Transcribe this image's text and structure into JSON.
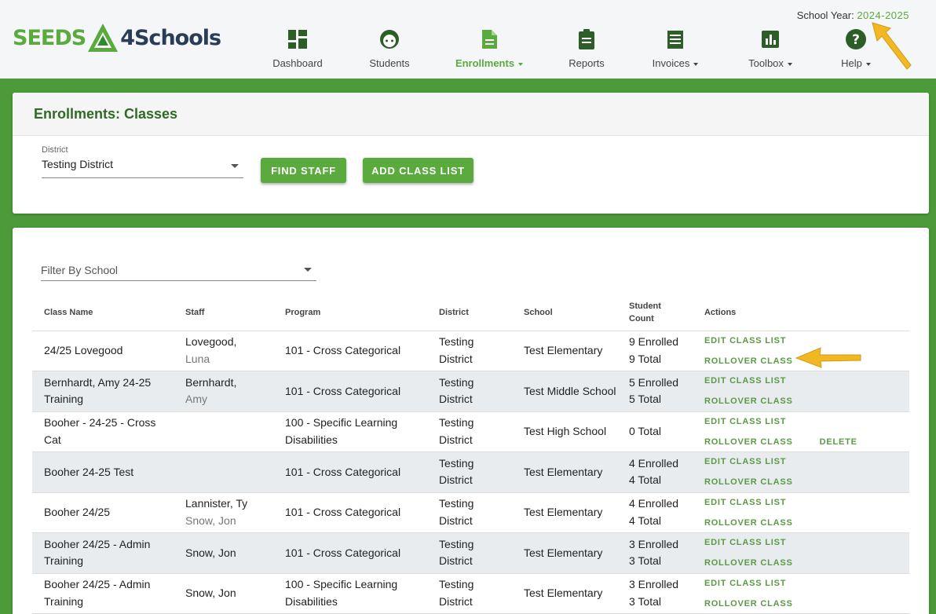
{
  "logo": {
    "part1": "SEEDS",
    "part2": "4Schools"
  },
  "school_year": {
    "label": "School Year:",
    "value": "2024-2025"
  },
  "nav": [
    {
      "label": "Dashboard",
      "icon": "dashboard-icon"
    },
    {
      "label": "Students",
      "icon": "student-face-icon"
    },
    {
      "label": "Enrollments",
      "icon": "document-icon"
    },
    {
      "label": "Reports",
      "icon": "clipboard-icon"
    },
    {
      "label": "Invoices",
      "icon": "receipt-icon"
    },
    {
      "label": "Toolbox",
      "icon": "bar-chart-icon"
    },
    {
      "label": "Help",
      "icon": "help-circle-icon"
    }
  ],
  "page": {
    "title": "Enrollments: Classes",
    "district_label": "District",
    "district_value": "Testing District",
    "find_staff": "FIND STAFF",
    "add_class_list": "ADD CLASS LIST",
    "filter_placeholder": "Filter By School"
  },
  "table": {
    "headers": [
      "Class Name",
      "Staff",
      "Program",
      "District",
      "School",
      "Student Count",
      "Actions"
    ],
    "actions": {
      "edit": "EDIT CLASS LIST",
      "rollover": "ROLLOVER CLASS",
      "delete": "DELETE"
    },
    "rows": [
      {
        "class_name": "24/25 Lovegood",
        "staff": [
          "Lovegood,",
          "Luna"
        ],
        "program": "101 - Cross Categorical",
        "district": [
          "Testing",
          "District"
        ],
        "school": "Test Elementary",
        "count": [
          "9 Enrolled",
          "9 Total"
        ]
      },
      {
        "class_name": "Bernhardt, Amy 24-25 Training",
        "staff": [
          "Bernhardt,",
          "Amy"
        ],
        "program": "101 - Cross Categorical",
        "district": [
          "Testing",
          "District"
        ],
        "school": "Test Middle School",
        "count": [
          "5 Enrolled",
          "5 Total"
        ]
      },
      {
        "class_name": "Booher - 24-25 - Cross Cat",
        "staff": [],
        "program": "100 - Specific Learning Disabilities",
        "district": [
          "Testing",
          "District"
        ],
        "school": "Test High School",
        "count": [
          "0 Total"
        ]
      },
      {
        "class_name": "Booher 24-25 Test",
        "staff": [],
        "program": "101 - Cross Categorical",
        "district": [
          "Testing",
          "District"
        ],
        "school": "Test Elementary",
        "count": [
          "4 Enrolled",
          "4 Total"
        ]
      },
      {
        "class_name": "Booher 24/25",
        "staff": [
          "Lannister, Ty",
          "Snow, Jon"
        ],
        "program": "101 - Cross Categorical",
        "district": [
          "Testing",
          "District"
        ],
        "school": "Test Elementary",
        "count": [
          "4 Enrolled",
          "4 Total"
        ]
      },
      {
        "class_name": "Booher 24/25 - Admin Training",
        "staff": [
          "Snow, Jon"
        ],
        "program": "101 - Cross Categorical",
        "district": [
          "Testing",
          "District"
        ],
        "school": "Test Elementary",
        "count": [
          "3 Enrolled",
          "3 Total"
        ]
      },
      {
        "class_name": "Booher 24/25 - Admin Training",
        "staff": [
          "Snow, Jon"
        ],
        "program": "100 - Specific Learning Disabilities",
        "district": [
          "Testing",
          "District"
        ],
        "school": "Test Elementary",
        "count": [
          "3 Enrolled",
          "3 Total"
        ]
      }
    ]
  },
  "colors": {
    "brand_green": "#5aaa3e",
    "dark_green": "#2e6b23",
    "navy": "#2a3d57",
    "arrow": "#f2b824"
  }
}
